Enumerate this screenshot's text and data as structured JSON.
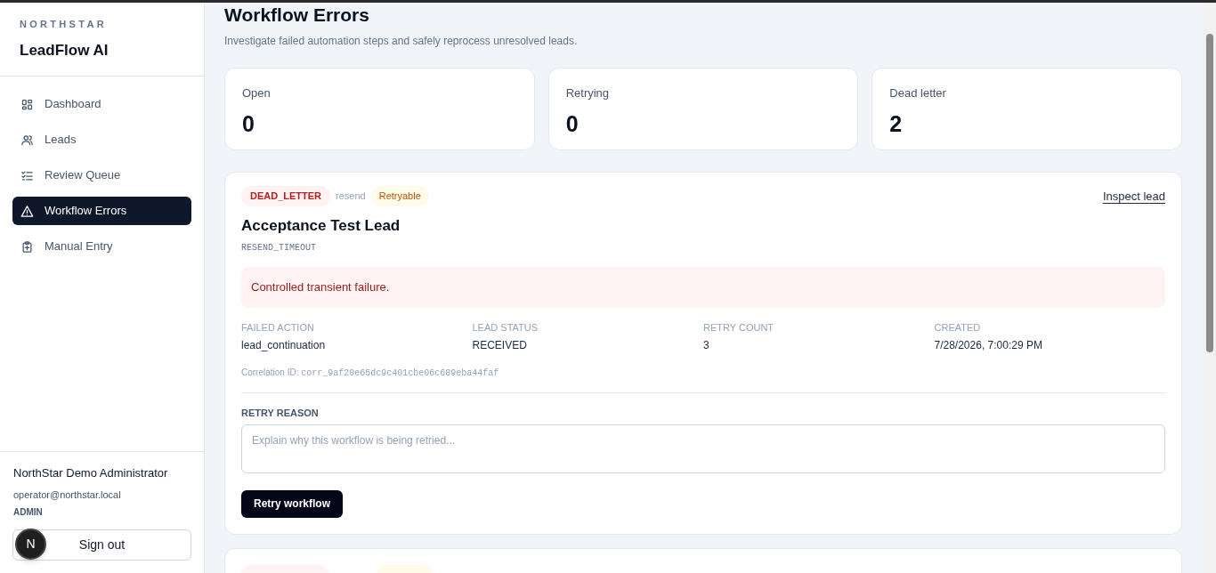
{
  "sidebar": {
    "brand_eyebrow": "NORTHSTAR",
    "brand": "LeadFlow AI",
    "items": [
      {
        "label": "Dashboard",
        "kind": "grid",
        "selected": false
      },
      {
        "label": "Leads",
        "kind": "users",
        "selected": false
      },
      {
        "label": "Review Queue",
        "kind": "checklist",
        "selected": false
      },
      {
        "label": "Workflow Errors",
        "kind": "warning",
        "selected": true
      },
      {
        "label": "Manual Entry",
        "kind": "clipboard",
        "selected": false
      }
    ],
    "user": {
      "name": "NorthStar Demo Administrator",
      "email": "operator@northstar.local",
      "role": "ADMIN",
      "avatar_letter": "N",
      "sign_out": "Sign out"
    }
  },
  "page": {
    "title": "Workflow Errors",
    "subtitle": "Investigate failed automation steps and safely reprocess unresolved leads."
  },
  "stats": [
    {
      "label": "Open",
      "value": "0"
    },
    {
      "label": "Retrying",
      "value": "0"
    },
    {
      "label": "Dead letter",
      "value": "2"
    }
  ],
  "errors": [
    {
      "status": "DEAD_LETTER",
      "action_tag": "resend",
      "retry_tag": "Retryable",
      "link": "Inspect lead",
      "lead_name": "Acceptance Test Lead",
      "code": "RESEND_TIMEOUT",
      "message": "Controlled transient failure.",
      "fields": [
        {
          "label": "FAILED ACTION",
          "value": "lead_continuation"
        },
        {
          "label": "LEAD STATUS",
          "value": "RECEIVED"
        },
        {
          "label": "RETRY COUNT",
          "value": "3"
        },
        {
          "label": "CREATED",
          "value": "7/28/2026, 7:00:29 PM"
        }
      ],
      "correlation_label": "Correlation ID:",
      "correlation_id": "corr_9af20e65dc9c401cbe06c689eba44faf",
      "retry_label": "RETRY REASON",
      "retry_placeholder": "Explain why this workflow is being retried...",
      "retry_button": "Retry workflow"
    }
  ]
}
